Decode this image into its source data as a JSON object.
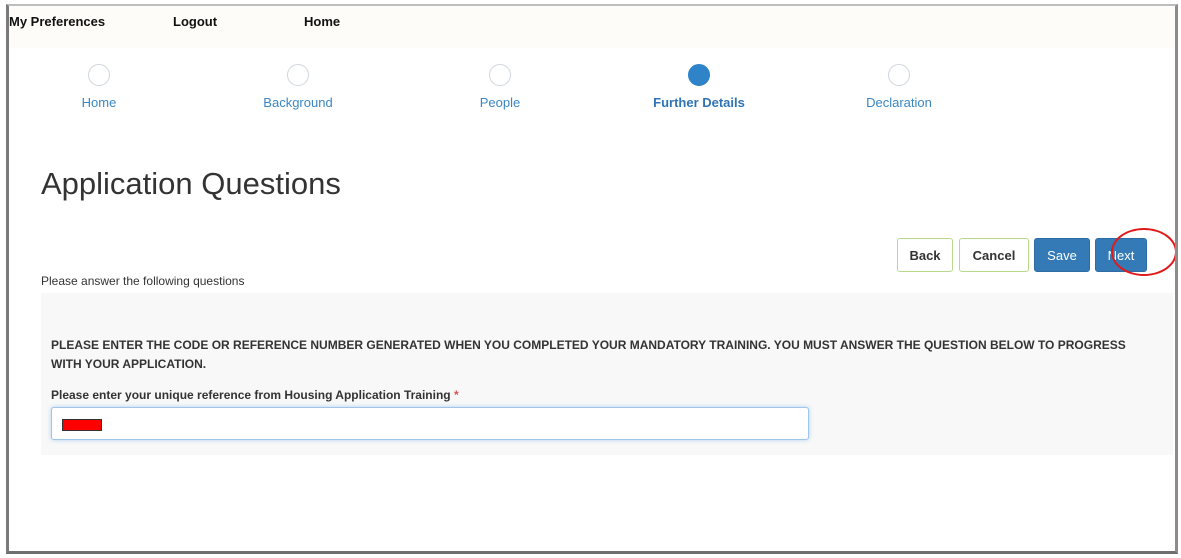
{
  "topnav": {
    "preferences": "My Preferences",
    "logout": "Logout",
    "home": "Home"
  },
  "steps": [
    {
      "label": "Home",
      "state": "incomplete"
    },
    {
      "label": "Background",
      "state": "incomplete"
    },
    {
      "label": "People",
      "state": "incomplete"
    },
    {
      "label": "Further Details",
      "state": "current"
    },
    {
      "label": "Declaration",
      "state": "incomplete"
    }
  ],
  "page": {
    "title": "Application Questions",
    "instruction": "Please answer the following questions"
  },
  "actions": {
    "back": "Back",
    "cancel": "Cancel",
    "save": "Save",
    "next": "Next"
  },
  "form": {
    "question": "PLEASE ENTER THE CODE OR REFERENCE NUMBER GENERATED WHEN YOU COMPLETED YOUR MANDATORY TRAINING. YOU MUST ANSWER THE QUESTION BELOW TO PROGRESS WITH YOUR APPLICATION.",
    "field_label": "Please enter your unique reference from Housing Application Training",
    "required_marker": "*",
    "value_redacted": true
  },
  "colors": {
    "accent": "#337ab7",
    "active_step": "#2e83c9",
    "highlight_ring": "#e01a1a",
    "redaction": "#ff0000"
  }
}
